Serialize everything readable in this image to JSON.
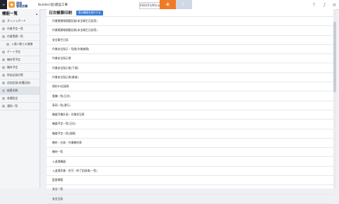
{
  "topbar": {
    "logo_text": "現場\n管理会議",
    "project_name": "Builder(仮)建設工事",
    "date_value": "2022/11/01(火)",
    "theme_light_icon": "sun-icon",
    "theme_dark_icon": "moon-icon",
    "help_icon": "help-icon",
    "bell_icon": "bell-icon",
    "menu_icon": "menu-icon"
  },
  "sidebar": {
    "title": "機能一覧",
    "items": [
      {
        "label": "ダッシュボード"
      },
      {
        "label": "作業予定一覧"
      },
      {
        "label": "作業実績一覧"
      },
      {
        "label": "入場人数との連携",
        "sub": true
      },
      {
        "label": "ゲート予定"
      },
      {
        "label": "機材等予定"
      },
      {
        "label": "機材予定"
      },
      {
        "label": "除染記録対策"
      },
      {
        "label": "追加記録(各種記録)"
      },
      {
        "label": "帳票印刷",
        "active": true
      },
      {
        "label": "各種設定"
      },
      {
        "label": "通知一覧"
      }
    ]
  },
  "main": {
    "title": "日次帳票印刷",
    "action_button": "表示確認を実行する",
    "rows": [
      "作業間連絡調整記録(安全衛生日誌用)",
      "作業間連絡調整記録(安全衛生日誌用)",
      "安全衛生日誌",
      "作業安全指示・危険(作業者間)",
      "作業安全指示書",
      "作業安全指示書(下請)",
      "作業安全指示書(業者)",
      "現状KY記録表",
      "重機一覧(日次)",
      "車両一覧(運行)",
      "機器予備計画・作業状況表",
      "機器予定一覧(日次)",
      "機器予定一覧(週間)",
      "機材・計画・作業機材表",
      "機材一覧",
      "入退場機器",
      "入退場作業・許可・終了記録書(一覧)",
      "監督補管",
      "安全一覧",
      "安全日誌"
    ]
  }
}
